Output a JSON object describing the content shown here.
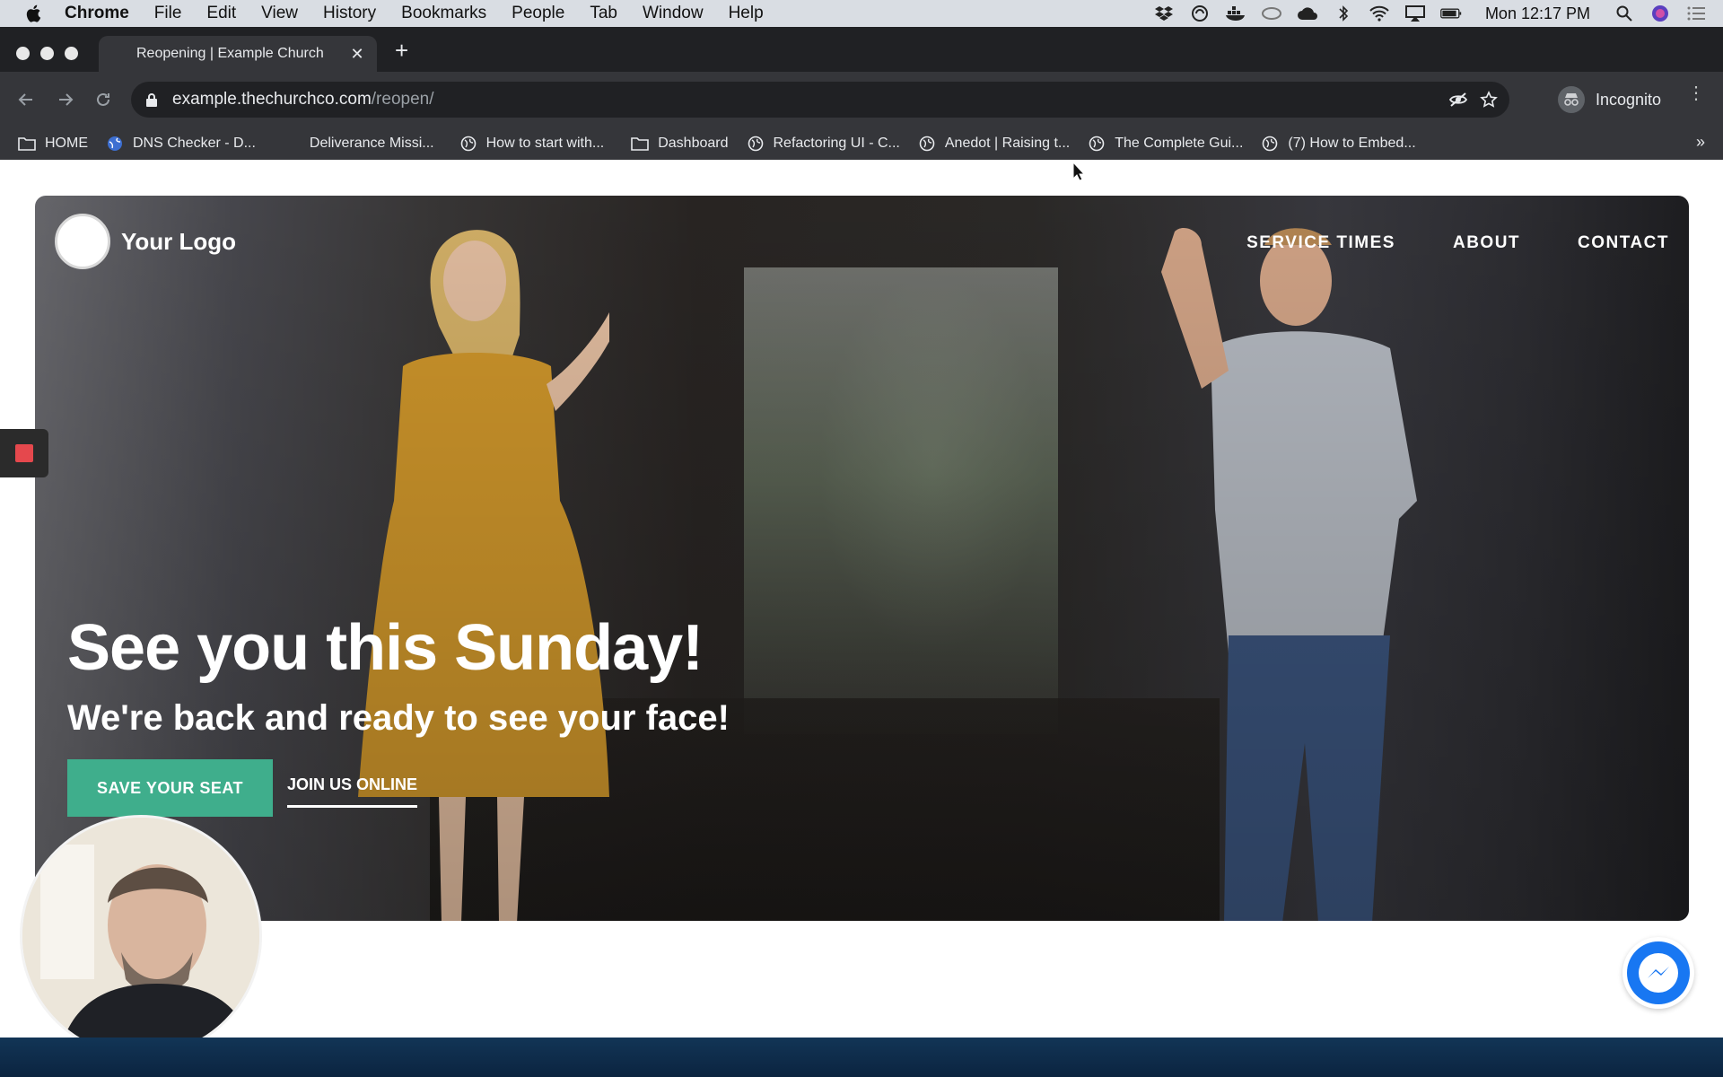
{
  "menubar": {
    "app": "Chrome",
    "items": [
      "File",
      "Edit",
      "View",
      "History",
      "Bookmarks",
      "People",
      "Tab",
      "Window",
      "Help"
    ],
    "clock": "Mon 12:17 PM"
  },
  "browser": {
    "tab_title": "Reopening | Example Church",
    "url_host": "example.thechurchco.com",
    "url_path": "/reopen/",
    "profile": "Incognito",
    "bookmarks": [
      {
        "label": "HOME",
        "icon": "folder-icon"
      },
      {
        "label": "DNS Checker - D...",
        "icon": "globe-icon"
      },
      {
        "label": "Deliverance Missi...",
        "icon": "blank-icon"
      },
      {
        "label": "How to start with...",
        "icon": "globe-icon"
      },
      {
        "label": "Dashboard",
        "icon": "folder-icon"
      },
      {
        "label": "Refactoring UI - C...",
        "icon": "globe-icon"
      },
      {
        "label": "Anedot | Raising t...",
        "icon": "globe-icon"
      },
      {
        "label": "The Complete Gui...",
        "icon": "globe-icon"
      },
      {
        "label": "(7) How to Embed...",
        "icon": "globe-icon"
      }
    ],
    "bookmarks_more": "»"
  },
  "site": {
    "logo_text": "Your Logo",
    "nav": [
      "SERVICE TIMES",
      "ABOUT",
      "CONTACT"
    ],
    "headline": "See you this Sunday!",
    "subhead": "We're back and ready to see your face!",
    "primary_button": "SAVE YOUR SEAT",
    "secondary_link": "JOIN US ONLINE",
    "accent_color": "#3fae8c"
  }
}
